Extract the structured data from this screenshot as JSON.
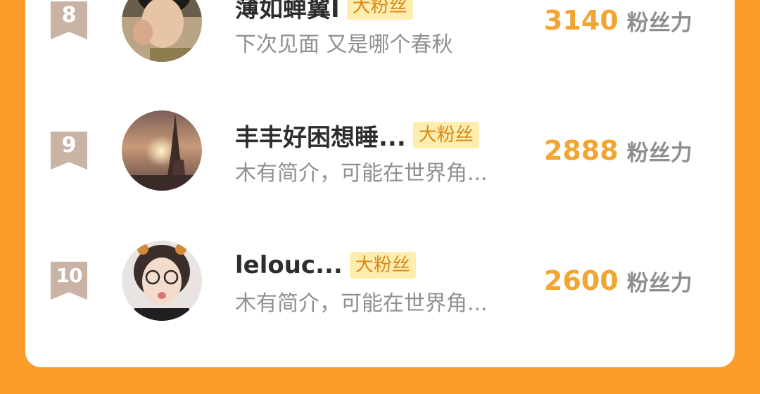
{
  "rows": [
    {
      "rank": "8",
      "name": "薄如蝉翼I",
      "tag": "大粉丝",
      "bio": "下次见面 又是哪个春秋",
      "score": "3140",
      "score_unit": "粉丝力"
    },
    {
      "rank": "9",
      "name": "丰丰好困想睡...",
      "tag": "大粉丝",
      "bio": "木有简介，可能在世界角...",
      "score": "2888",
      "score_unit": "粉丝力"
    },
    {
      "rank": "10",
      "name": "lelouc...",
      "tag": "大粉丝",
      "bio": "木有简介，可能在世界角...",
      "score": "2600",
      "score_unit": "粉丝力"
    }
  ],
  "colors": {
    "page_background": "#fb9b2a",
    "card_background": "#ffffff",
    "rank_badge": "#c9b3a4",
    "score": "#f2a531",
    "tag_background": "#fdeeb0",
    "tag_text": "#d9881a"
  }
}
